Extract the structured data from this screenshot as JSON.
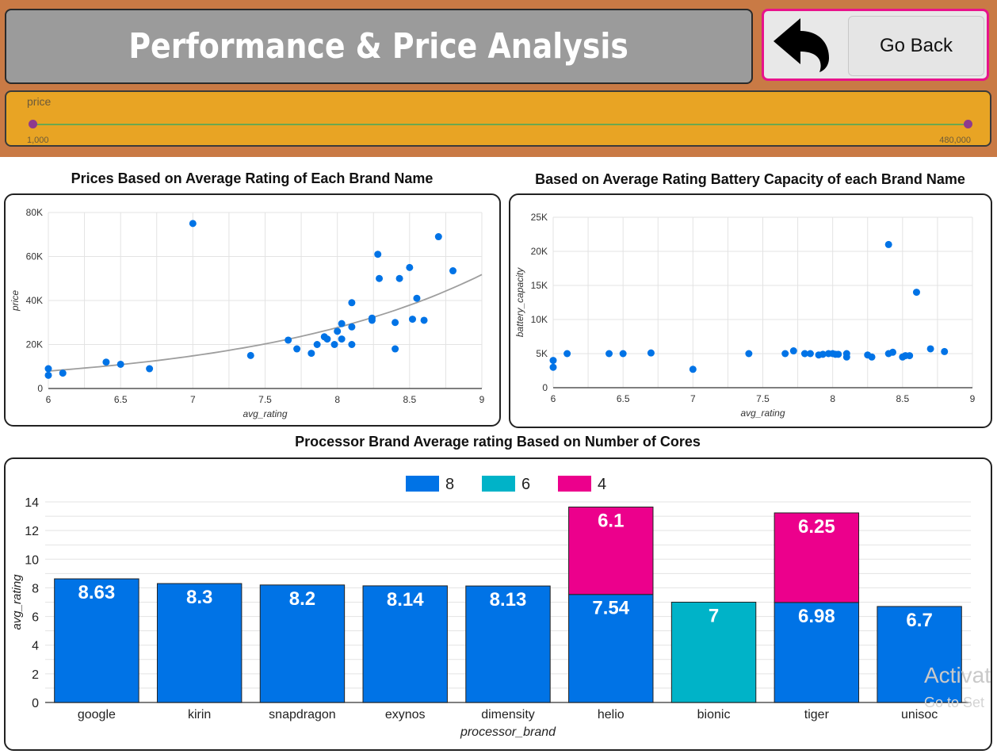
{
  "header": {
    "title": "Performance & Price Analysis",
    "go_back_label": "Go Back",
    "back_icon": "back-arrow-icon"
  },
  "price_filter": {
    "label": "price",
    "min_label": "1,000",
    "max_label": "480,000",
    "min": 1000,
    "max": 480000,
    "low_handle_fraction": 0,
    "high_handle_fraction": 1
  },
  "watermark": {
    "line1": "Activat",
    "line2": "Go to Set"
  },
  "colors": {
    "header_band": "#c97a45",
    "title_box": "#9b9b9b",
    "slider_box": "#e8a424",
    "go_back_border": "#e8138b",
    "series_8": "#0073e6",
    "series_6": "#00b3c8",
    "series_4": "#ec008c",
    "trendline": "#9e9e9e"
  },
  "chart_data": [
    {
      "id": "price_scatter",
      "type": "scatter",
      "title": "Prices Based on Average Rating of Each Brand Name",
      "xlabel": "avg_rating",
      "ylabel": "price",
      "xlim": [
        6,
        9
      ],
      "ylim": [
        0,
        80000
      ],
      "x_ticks": [
        "6",
        "6.5",
        "7",
        "7.5",
        "8",
        "8.5",
        "9"
      ],
      "y_ticks": [
        "0",
        "20K",
        "40K",
        "60K",
        "80K"
      ],
      "trendline": "exponential",
      "grid": true,
      "points": [
        [
          6,
          9000
        ],
        [
          6,
          6000
        ],
        [
          6.1,
          7000
        ],
        [
          6.4,
          12000
        ],
        [
          6.5,
          11000
        ],
        [
          6.7,
          9000
        ],
        [
          7,
          75000
        ],
        [
          7.4,
          15000
        ],
        [
          7.66,
          22000
        ],
        [
          7.72,
          18000
        ],
        [
          7.82,
          16000
        ],
        [
          7.86,
          20000
        ],
        [
          7.91,
          23500
        ],
        [
          7.93,
          22500
        ],
        [
          7.98,
          20000
        ],
        [
          8,
          26000
        ],
        [
          8.03,
          29500
        ],
        [
          8.03,
          22500
        ],
        [
          8.1,
          39000
        ],
        [
          8.1,
          28000
        ],
        [
          8.1,
          20000
        ],
        [
          8.24,
          32000
        ],
        [
          8.24,
          31000
        ],
        [
          8.28,
          61000
        ],
        [
          8.29,
          50000
        ],
        [
          8.4,
          30000
        ],
        [
          8.4,
          18000
        ],
        [
          8.43,
          50000
        ],
        [
          8.5,
          55000
        ],
        [
          8.52,
          31500
        ],
        [
          8.55,
          41000
        ],
        [
          8.6,
          31000
        ],
        [
          8.7,
          69000
        ],
        [
          8.8,
          53500
        ]
      ]
    },
    {
      "id": "battery_scatter",
      "type": "scatter",
      "title": "Based on Average Rating Battery Capacity of each Brand Name",
      "xlabel": "avg_rating",
      "ylabel": "battery_capacity",
      "xlim": [
        6,
        9
      ],
      "ylim": [
        0,
        25000
      ],
      "x_ticks": [
        "6",
        "6.5",
        "7",
        "7.5",
        "8",
        "8.5",
        "9"
      ],
      "y_ticks": [
        "0",
        "5K",
        "10K",
        "15K",
        "20K",
        "25K"
      ],
      "grid": true,
      "points": [
        [
          6,
          4000
        ],
        [
          6,
          3000
        ],
        [
          6.1,
          5000
        ],
        [
          6.4,
          5000
        ],
        [
          6.5,
          5000
        ],
        [
          6.7,
          5100
        ],
        [
          7,
          2700
        ],
        [
          7.4,
          5000
        ],
        [
          7.66,
          5000
        ],
        [
          7.72,
          5400
        ],
        [
          7.8,
          5000
        ],
        [
          7.84,
          5000
        ],
        [
          7.9,
          4800
        ],
        [
          7.93,
          4900
        ],
        [
          7.97,
          5000
        ],
        [
          8,
          5000
        ],
        [
          8.02,
          4900
        ],
        [
          8.04,
          4900
        ],
        [
          8.1,
          5000
        ],
        [
          8.1,
          4500
        ],
        [
          8.25,
          4800
        ],
        [
          8.28,
          4500
        ],
        [
          8.4,
          5000
        ],
        [
          8.4,
          21000
        ],
        [
          8.43,
          5200
        ],
        [
          8.5,
          4500
        ],
        [
          8.52,
          4700
        ],
        [
          8.55,
          4700
        ],
        [
          8.6,
          14000
        ],
        [
          8.7,
          5700
        ],
        [
          8.8,
          5300
        ]
      ]
    },
    {
      "id": "processor_bar",
      "type": "bar",
      "stacked": true,
      "title": "Processor Brand Average rating Based on Number of Cores",
      "xlabel": "processor_brand",
      "ylabel": "avg_rating",
      "ylim": [
        0,
        14
      ],
      "y_ticks": [
        "0",
        "2",
        "4",
        "6",
        "8",
        "10",
        "12",
        "14"
      ],
      "legend_position": "top-center",
      "categories": [
        "google",
        "kirin",
        "snapdragon",
        "exynos",
        "dimensity",
        "helio",
        "bionic",
        "tiger",
        "unisoc"
      ],
      "series": [
        {
          "name": "8",
          "values": [
            8.63,
            8.3,
            8.2,
            8.14,
            8.13,
            7.54,
            0,
            6.98,
            6.7
          ],
          "labels": [
            "8.63",
            "8.3",
            "8.2",
            "8.14",
            "8.13",
            "7.54",
            "",
            "6.98",
            "6.7"
          ]
        },
        {
          "name": "6",
          "values": [
            0,
            0,
            0,
            0,
            0,
            0,
            7,
            0,
            0
          ],
          "labels": [
            "",
            "",
            "",
            "",
            "",
            "",
            "7",
            "",
            ""
          ]
        },
        {
          "name": "4",
          "values": [
            0,
            0,
            0,
            0,
            0,
            6.1,
            0,
            6.25,
            0
          ],
          "labels": [
            "",
            "",
            "",
            "",
            "",
            "6.1",
            "",
            "6.25",
            ""
          ]
        }
      ]
    }
  ]
}
